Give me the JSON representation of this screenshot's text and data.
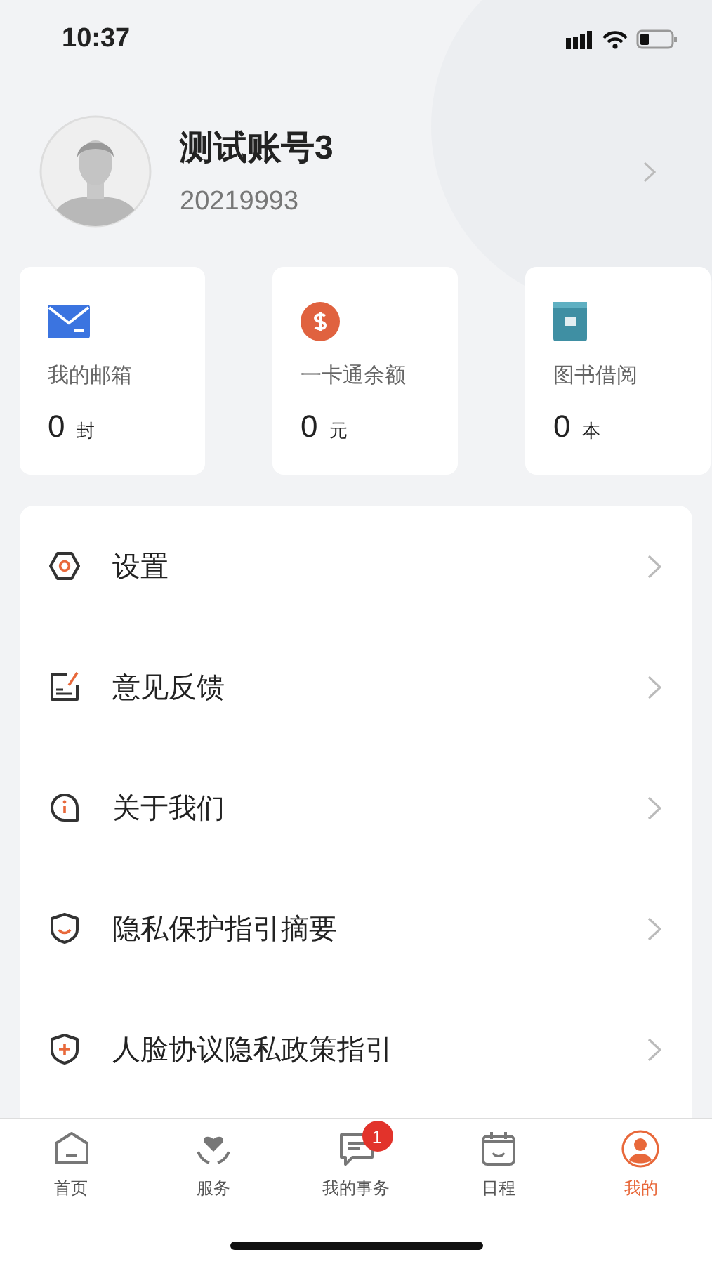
{
  "status_bar": {
    "time": "10:37"
  },
  "profile": {
    "name": "测试账号3",
    "account": "20219993"
  },
  "stats": [
    {
      "label": "我的邮箱",
      "value": "0",
      "unit": "封"
    },
    {
      "label": "一卡通余额",
      "value": "0",
      "unit": "元"
    },
    {
      "label": "图书借阅",
      "value": "0",
      "unit": "本"
    }
  ],
  "menu": [
    {
      "label": "设置"
    },
    {
      "label": "意见反馈"
    },
    {
      "label": "关于我们"
    },
    {
      "label": "隐私保护指引摘要"
    },
    {
      "label": "人脸协议隐私政策指引"
    }
  ],
  "tab_bar": [
    {
      "label": "首页",
      "selected": false
    },
    {
      "label": "服务",
      "selected": false
    },
    {
      "label": "我的事务",
      "selected": false,
      "badge": "1"
    },
    {
      "label": "日程",
      "selected": false
    },
    {
      "label": "我的",
      "selected": true
    }
  ]
}
